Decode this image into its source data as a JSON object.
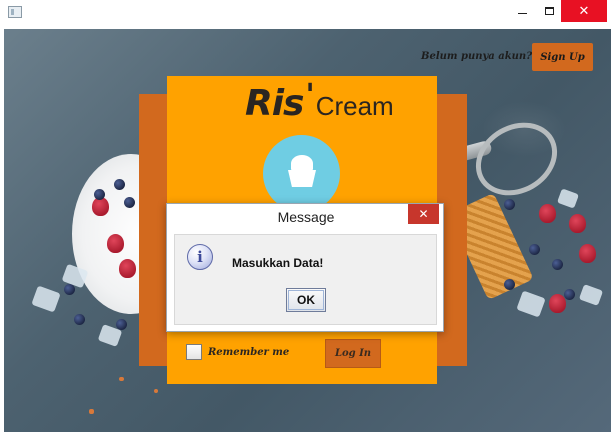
{
  "window": {
    "minimize_glyph": "",
    "close_glyph": "✕"
  },
  "header": {
    "signup_prompt": "Belum punya akun?",
    "signup_label": "Sign Up"
  },
  "brand": {
    "part1": "Ris",
    "apostrophe": "'",
    "part2": "Cream"
  },
  "login": {
    "remember_label": "Remember me",
    "remember_checked": false,
    "login_label": "Log In"
  },
  "dialog": {
    "title": "Message",
    "close_glyph": "✕",
    "icon_glyph": "i",
    "message": "Masukkan Data!",
    "ok_label": "OK"
  },
  "colors": {
    "card": "#ffa200",
    "accent": "#d2691e",
    "logo_circle": "#6fcde3",
    "close_red": "#e81123"
  },
  "icons": {
    "app": "app-window-icon",
    "logo": "ice-cream-cup-icon",
    "dialog": "info-icon"
  }
}
